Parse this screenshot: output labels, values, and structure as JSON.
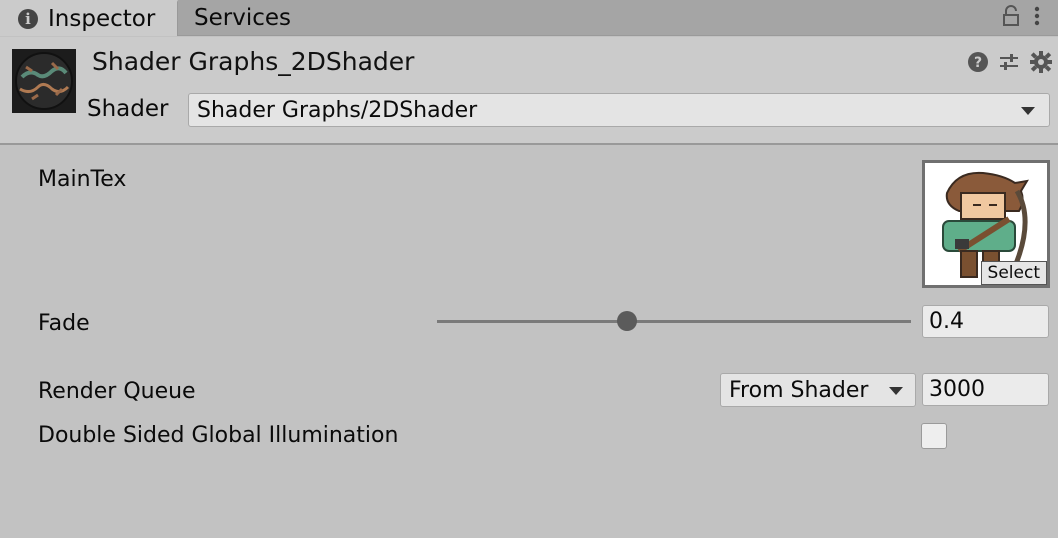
{
  "tabs": [
    {
      "label": "Inspector",
      "active": true,
      "icon": "info-icon"
    },
    {
      "label": "Services",
      "active": false
    }
  ],
  "tabbar_icons": [
    "lock-icon",
    "kebab-menu-icon"
  ],
  "header": {
    "title": "Shader Graphs_2DShader",
    "shader_label": "Shader",
    "shader_value": "Shader Graphs/2DShader",
    "icons": [
      "help-icon",
      "preset-sliders-icon",
      "gear-icon"
    ]
  },
  "properties": {
    "maintex": {
      "label": "MainTex",
      "select_label": "Select"
    },
    "fade": {
      "label": "Fade",
      "value": "0.4",
      "slider_fraction": 0.4
    },
    "render_queue": {
      "label": "Render Queue",
      "mode": "From Shader",
      "value": "3000"
    },
    "double_sided_gi": {
      "label": "Double Sided Global Illumination",
      "checked": false
    }
  },
  "colors": {
    "background": "#c2c2c2",
    "header": "#cbcbcb",
    "tabbar": "#a5a5a5"
  }
}
